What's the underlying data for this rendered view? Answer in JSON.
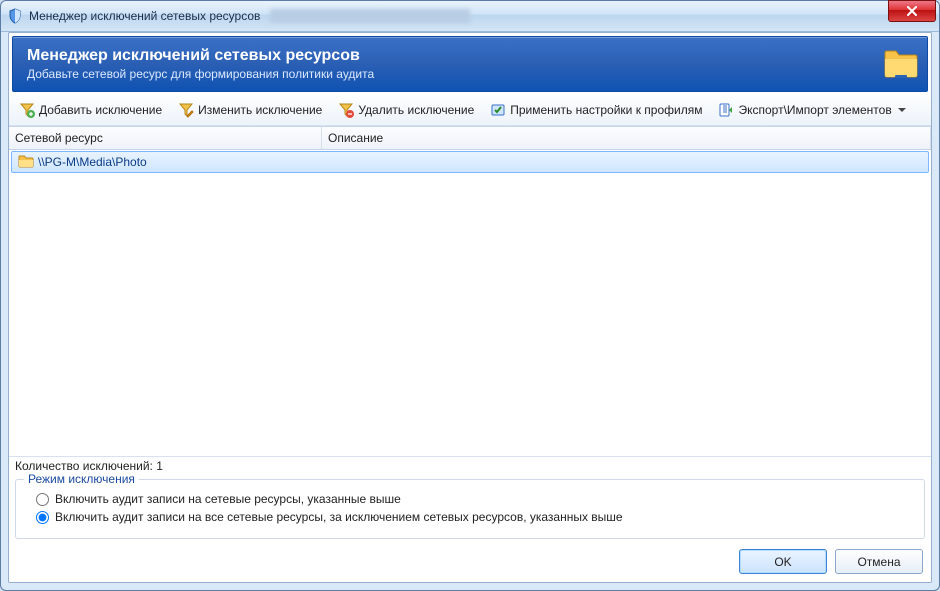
{
  "window": {
    "title": "Менеджер исключений сетевых ресурсов"
  },
  "banner": {
    "title": "Менеджер исключений сетевых ресурсов",
    "subtitle": "Добавьте сетевой ресурс для формирования политики аудита"
  },
  "toolbar": {
    "add": "Добавить исключение",
    "edit": "Изменить исключение",
    "delete": "Удалить исключение",
    "apply": "Применить настройки к профилям",
    "export_import": "Экспорт\\Импорт элементов"
  },
  "grid": {
    "columns": {
      "resource": "Сетевой ресурс",
      "description": "Описание"
    },
    "rows": [
      {
        "resource": "\\\\PG-M\\Media\\Photo",
        "description": ""
      }
    ]
  },
  "count": {
    "label": "Количество исключений:",
    "value": "1"
  },
  "mode": {
    "legend": "Режим исключения",
    "opt_include": "Включить аудит записи на сетевые ресурсы, указанные выше",
    "opt_exclude": "Включить аудит записи на все сетевые ресурсы, за исключением сетевых ресурсов, указанных выше",
    "selected": "exclude"
  },
  "buttons": {
    "ok": "OK",
    "cancel": "Отмена"
  }
}
